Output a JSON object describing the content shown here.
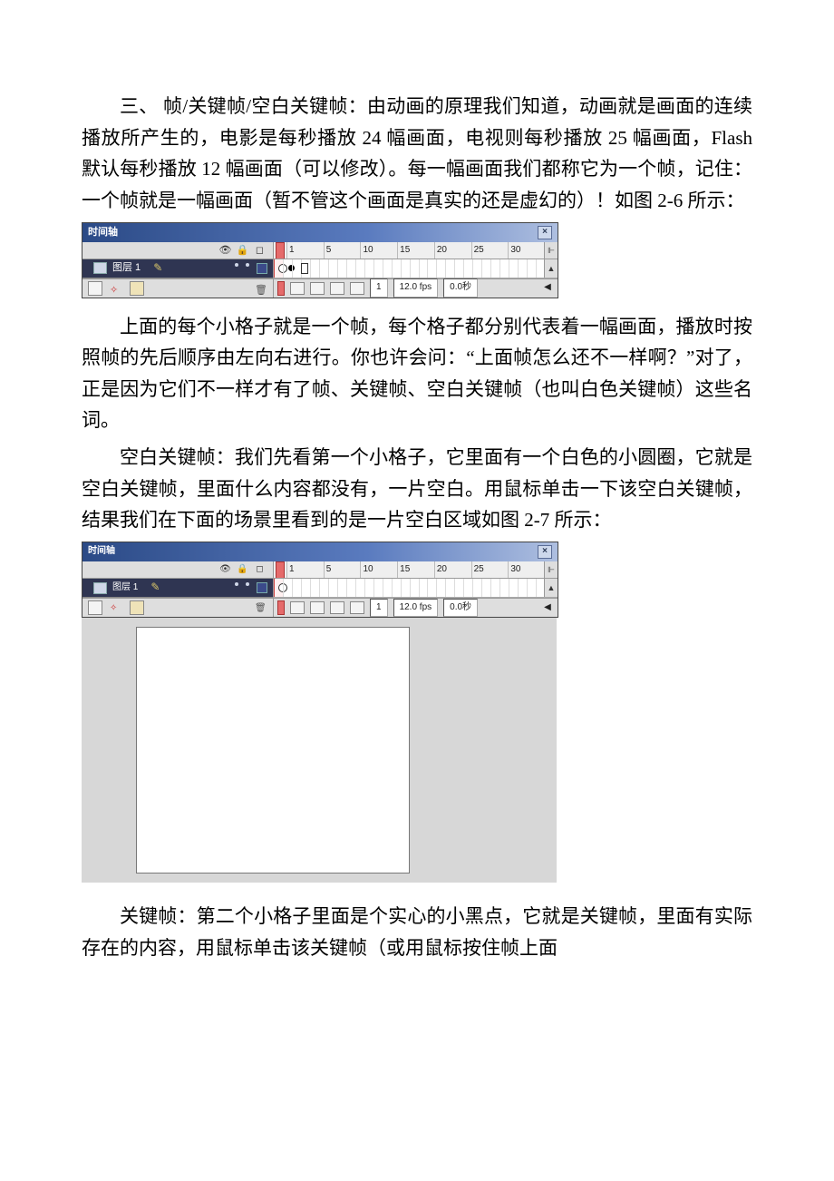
{
  "para1": "三、 帧/关键帧/空白关键帧：由动画的原理我们知道，动画就是画面的连续播放所产生的，电影是每秒播放 24 幅画面，电视则每秒播放 25 幅画面，Flash 默认每秒播放 12 幅画面（可以修改）。每一幅画面我们都称它为一个帧，记住：一个帧就是一幅画面（暂不管这个画面是真实的还是虚幻的）！如图 2-6 所示：",
  "para2": "上面的每个小格子就是一个帧，每个格子都分别代表着一幅画面，播放时按照帧的先后顺序由左向右进行。你也许会问：“上面帧怎么还不一样啊？”对了，正是因为它们不一样才有了帧、关键帧、空白关键帧（也叫白色关键帧）这些名词。",
  "para3": "空白关键帧：我们先看第一个小格子，它里面有一个白色的小圆圈，它就是空白关键帧，里面什么内容都没有，一片空白。用鼠标单击一下该空白关键帧，结果我们在下面的场景里看到的是一片空白区域如图 2-7 所示：",
  "para4": "关键帧：第二个小格子里面是个实心的小黑点，它就是关键帧，里面有实际存在的内容，用鼠标单击该关键帧（或用鼠标按住帧上面",
  "timeline": {
    "title": "时间轴",
    "layer_name": "图层 1",
    "ruler_ticks": [
      "1",
      "5",
      "10",
      "15",
      "20",
      "25",
      "30"
    ],
    "end_symbol": "⊩",
    "status_frame": "1",
    "status_fps": "12.0 fps",
    "status_time": "0.0秒"
  }
}
